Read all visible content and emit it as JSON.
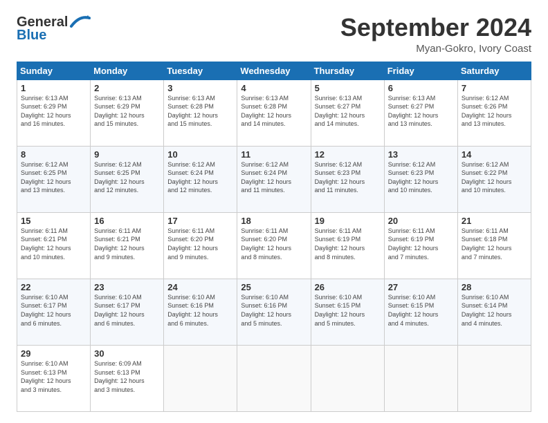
{
  "header": {
    "logo_general": "General",
    "logo_blue": "Blue",
    "month": "September 2024",
    "location": "Myan-Gokro, Ivory Coast"
  },
  "weekdays": [
    "Sunday",
    "Monday",
    "Tuesday",
    "Wednesday",
    "Thursday",
    "Friday",
    "Saturday"
  ],
  "weeks": [
    [
      {
        "day": "1",
        "info": "Sunrise: 6:13 AM\nSunset: 6:29 PM\nDaylight: 12 hours\nand 16 minutes."
      },
      {
        "day": "2",
        "info": "Sunrise: 6:13 AM\nSunset: 6:29 PM\nDaylight: 12 hours\nand 15 minutes."
      },
      {
        "day": "3",
        "info": "Sunrise: 6:13 AM\nSunset: 6:28 PM\nDaylight: 12 hours\nand 15 minutes."
      },
      {
        "day": "4",
        "info": "Sunrise: 6:13 AM\nSunset: 6:28 PM\nDaylight: 12 hours\nand 14 minutes."
      },
      {
        "day": "5",
        "info": "Sunrise: 6:13 AM\nSunset: 6:27 PM\nDaylight: 12 hours\nand 14 minutes."
      },
      {
        "day": "6",
        "info": "Sunrise: 6:13 AM\nSunset: 6:27 PM\nDaylight: 12 hours\nand 13 minutes."
      },
      {
        "day": "7",
        "info": "Sunrise: 6:12 AM\nSunset: 6:26 PM\nDaylight: 12 hours\nand 13 minutes."
      }
    ],
    [
      {
        "day": "8",
        "info": "Sunrise: 6:12 AM\nSunset: 6:25 PM\nDaylight: 12 hours\nand 13 minutes."
      },
      {
        "day": "9",
        "info": "Sunrise: 6:12 AM\nSunset: 6:25 PM\nDaylight: 12 hours\nand 12 minutes."
      },
      {
        "day": "10",
        "info": "Sunrise: 6:12 AM\nSunset: 6:24 PM\nDaylight: 12 hours\nand 12 minutes."
      },
      {
        "day": "11",
        "info": "Sunrise: 6:12 AM\nSunset: 6:24 PM\nDaylight: 12 hours\nand 11 minutes."
      },
      {
        "day": "12",
        "info": "Sunrise: 6:12 AM\nSunset: 6:23 PM\nDaylight: 12 hours\nand 11 minutes."
      },
      {
        "day": "13",
        "info": "Sunrise: 6:12 AM\nSunset: 6:23 PM\nDaylight: 12 hours\nand 10 minutes."
      },
      {
        "day": "14",
        "info": "Sunrise: 6:12 AM\nSunset: 6:22 PM\nDaylight: 12 hours\nand 10 minutes."
      }
    ],
    [
      {
        "day": "15",
        "info": "Sunrise: 6:11 AM\nSunset: 6:21 PM\nDaylight: 12 hours\nand 10 minutes."
      },
      {
        "day": "16",
        "info": "Sunrise: 6:11 AM\nSunset: 6:21 PM\nDaylight: 12 hours\nand 9 minutes."
      },
      {
        "day": "17",
        "info": "Sunrise: 6:11 AM\nSunset: 6:20 PM\nDaylight: 12 hours\nand 9 minutes."
      },
      {
        "day": "18",
        "info": "Sunrise: 6:11 AM\nSunset: 6:20 PM\nDaylight: 12 hours\nand 8 minutes."
      },
      {
        "day": "19",
        "info": "Sunrise: 6:11 AM\nSunset: 6:19 PM\nDaylight: 12 hours\nand 8 minutes."
      },
      {
        "day": "20",
        "info": "Sunrise: 6:11 AM\nSunset: 6:19 PM\nDaylight: 12 hours\nand 7 minutes."
      },
      {
        "day": "21",
        "info": "Sunrise: 6:11 AM\nSunset: 6:18 PM\nDaylight: 12 hours\nand 7 minutes."
      }
    ],
    [
      {
        "day": "22",
        "info": "Sunrise: 6:10 AM\nSunset: 6:17 PM\nDaylight: 12 hours\nand 6 minutes."
      },
      {
        "day": "23",
        "info": "Sunrise: 6:10 AM\nSunset: 6:17 PM\nDaylight: 12 hours\nand 6 minutes."
      },
      {
        "day": "24",
        "info": "Sunrise: 6:10 AM\nSunset: 6:16 PM\nDaylight: 12 hours\nand 6 minutes."
      },
      {
        "day": "25",
        "info": "Sunrise: 6:10 AM\nSunset: 6:16 PM\nDaylight: 12 hours\nand 5 minutes."
      },
      {
        "day": "26",
        "info": "Sunrise: 6:10 AM\nSunset: 6:15 PM\nDaylight: 12 hours\nand 5 minutes."
      },
      {
        "day": "27",
        "info": "Sunrise: 6:10 AM\nSunset: 6:15 PM\nDaylight: 12 hours\nand 4 minutes."
      },
      {
        "day": "28",
        "info": "Sunrise: 6:10 AM\nSunset: 6:14 PM\nDaylight: 12 hours\nand 4 minutes."
      }
    ],
    [
      {
        "day": "29",
        "info": "Sunrise: 6:10 AM\nSunset: 6:13 PM\nDaylight: 12 hours\nand 3 minutes."
      },
      {
        "day": "30",
        "info": "Sunrise: 6:09 AM\nSunset: 6:13 PM\nDaylight: 12 hours\nand 3 minutes."
      },
      {
        "day": "",
        "info": ""
      },
      {
        "day": "",
        "info": ""
      },
      {
        "day": "",
        "info": ""
      },
      {
        "day": "",
        "info": ""
      },
      {
        "day": "",
        "info": ""
      }
    ]
  ]
}
